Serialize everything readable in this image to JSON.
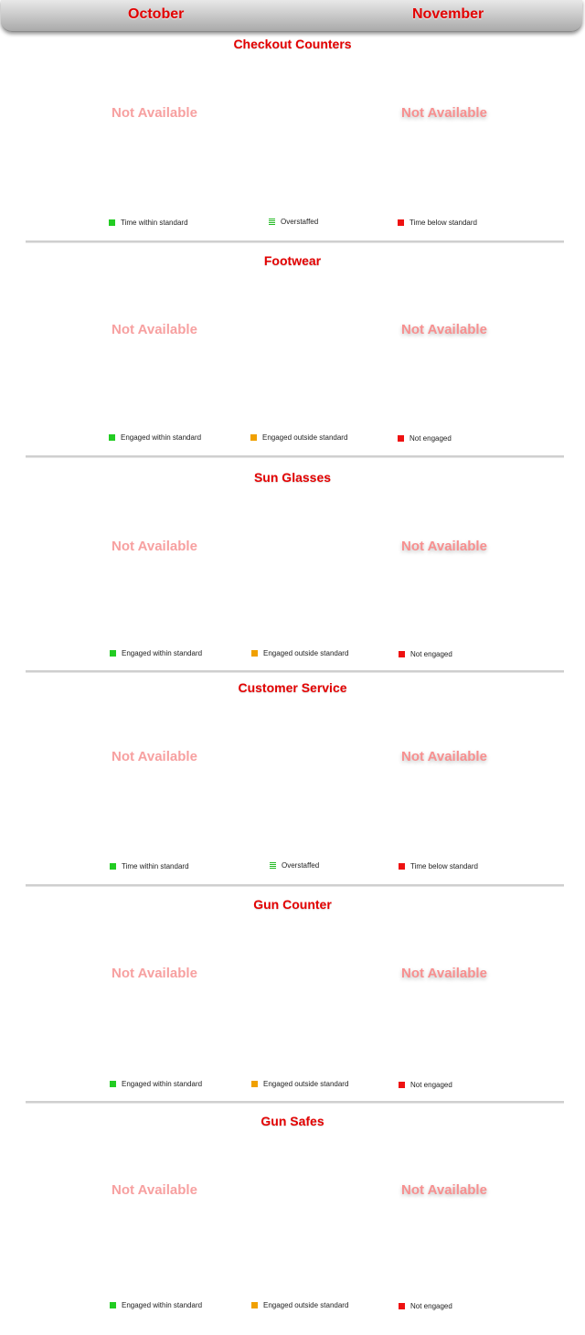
{
  "header": {
    "months": [
      "October",
      "November"
    ]
  },
  "sections": [
    {
      "title": "Checkout Counters",
      "october_status": "Not Available",
      "november_status": "Not Available",
      "legend": [
        "Time within standard",
        "Overstaffed",
        "Time below standard"
      ]
    },
    {
      "title": "Footwear",
      "october_status": "Not Available",
      "november_status": "Not Available",
      "legend": [
        "Engaged within standard",
        "Engaged outside standard",
        "Not engaged"
      ]
    },
    {
      "title": "Sun Glasses",
      "october_status": "Not Available",
      "november_status": "Not Available",
      "legend": [
        "Engaged within standard",
        "Engaged outside standard",
        "Not engaged"
      ]
    },
    {
      "title": "Customer Service",
      "october_status": "Not Available",
      "november_status": "Not Available",
      "legend": [
        "Time within standard",
        "Overstaffed",
        "Time below standard"
      ]
    },
    {
      "title": "Gun Counter",
      "october_status": "Not Available",
      "november_status": "Not Available",
      "legend": [
        "Engaged within standard",
        "Engaged outside standard",
        "Not engaged"
      ]
    },
    {
      "title": "Gun Safes",
      "october_status": "Not Available",
      "november_status": "Not Available",
      "legend": [
        "Engaged within standard",
        "Engaged outside standard",
        "Not engaged"
      ]
    }
  ],
  "colors": {
    "heading_red": "#e30000",
    "within_standard_green": "#22cc22",
    "outside_standard_orange": "#f0a000",
    "below_standard_red": "#ee1111"
  }
}
